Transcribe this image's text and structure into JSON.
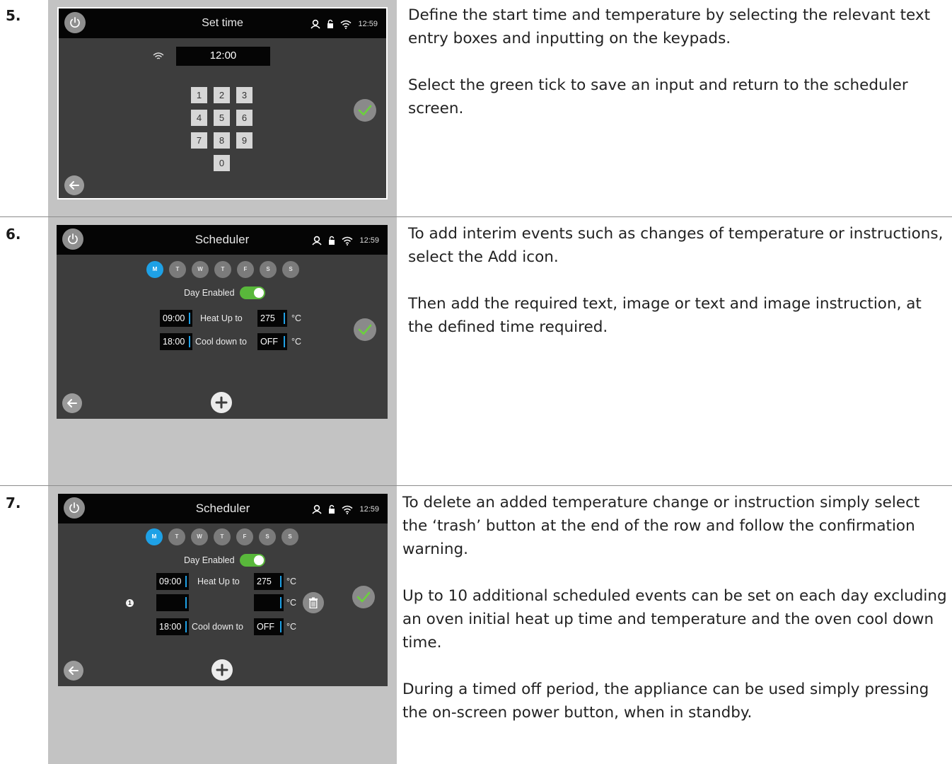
{
  "steps": [
    {
      "number": "5.",
      "paragraphs": [
        "Define the start time and temperature by selecting the relevant text entry boxes and inputting on the keypads.",
        "Select the green tick to save an input and return to the scheduler screen."
      ],
      "screen": {
        "title": "Set time",
        "clock": "12:59",
        "time_value": "12:00",
        "keys": [
          "1",
          "2",
          "3",
          "4",
          "5",
          "6",
          "7",
          "8",
          "9",
          "0"
        ]
      }
    },
    {
      "number": "6.",
      "paragraphs": [
        "To add interim events such as changes of temperature or instructions, select the Add icon.",
        "Then add the required text, image or text and image instruction, at the defined time required."
      ],
      "screen": {
        "title": "Scheduler",
        "clock": "12:59",
        "days": [
          "M",
          "T",
          "W",
          "T",
          "F",
          "S",
          "S"
        ],
        "active_day": "M",
        "day_enabled_label": "Day Enabled",
        "day_enabled": true,
        "rows": [
          {
            "time": "09:00",
            "action": "Heat Up to",
            "temp": "275",
            "unit": "°C"
          },
          {
            "time": "18:00",
            "action": "Cool down to",
            "temp": "OFF",
            "unit": "°C"
          }
        ]
      }
    },
    {
      "number": "7.",
      "paragraphs": [
        "To delete an added temperature change or instruction simply select the ‘trash’ button at the end of the row and follow the confirmation warning.",
        "Up to 10 additional scheduled events can be set on each day excluding an oven initial heat up time and temperature and the oven cool down time.",
        "During a timed off period, the appliance can be used simply pressing the on-screen power button, when in standby."
      ],
      "screen": {
        "title": "Scheduler",
        "clock": "12:59",
        "days": [
          "M",
          "T",
          "W",
          "T",
          "F",
          "S",
          "S"
        ],
        "active_day": "M",
        "day_enabled_label": "Day Enabled",
        "day_enabled": true,
        "info_marker": "1",
        "rows": [
          {
            "time": "09:00",
            "action": "Heat Up to",
            "temp": "275",
            "unit": "°C"
          },
          {
            "time": "",
            "action": "",
            "temp": "",
            "unit": "°C"
          },
          {
            "time": "18:00",
            "action": "Cool down to",
            "temp": "OFF",
            "unit": "°C"
          }
        ]
      }
    }
  ],
  "colors": {
    "screen_bg": "#3d3d3d",
    "topbar_bg": "#050505",
    "active_day": "#1ea1e6",
    "toggle_on": "#59b83b",
    "tick": "#6ccf3f",
    "column_bg": "#c3c3c3"
  },
  "icons": [
    "power-icon",
    "user-icon",
    "lock-icon",
    "wifi-icon",
    "back-arrow-icon",
    "tick-icon",
    "add-icon",
    "trash-icon"
  ]
}
